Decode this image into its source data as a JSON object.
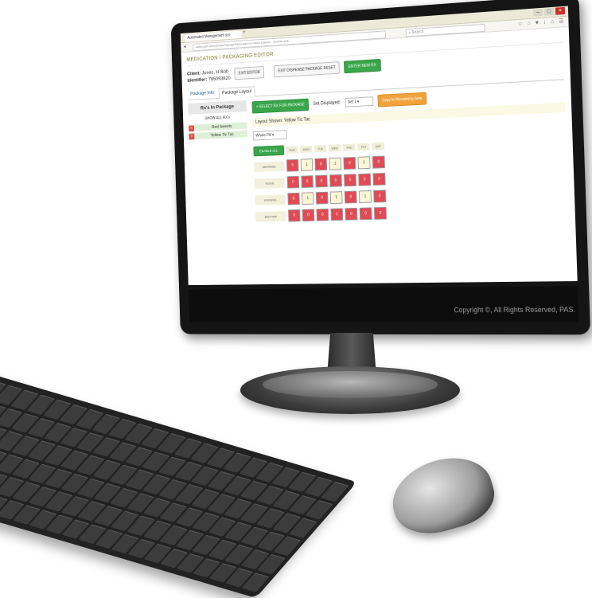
{
  "browser": {
    "tab_title": "Automated Management sys",
    "url": "www.pasit.net/example/PackageEditor.aspx?a=m&id=1&item=...&mode=edit",
    "search_placeholder": "Search"
  },
  "app": {
    "title": "MEDICATION / PACKAGING EDITOR",
    "client_label": "Client:",
    "client_value": "Jones, H Bob",
    "identifier_label": "Identifier:",
    "identifier_value": "785093820",
    "buttons": {
      "exit_editor": "EXIT EDITOR",
      "exit_dispense": "EXIT DISPENSE PACKAGE RESET",
      "enter_new_rx": "ENTER NEW RX"
    },
    "tabs": [
      "Package Info",
      "Package Layout"
    ]
  },
  "rx_panel": {
    "header": "Rx's In Package",
    "show_all": "SHOW ALL RX's",
    "items": [
      {
        "label": "Red Sweets"
      },
      {
        "label": "Yellow Tic Tac"
      }
    ]
  },
  "layout": {
    "select_rx_button": "+ SELECT RX FOR PACKAGE",
    "set_displayed_label": "Set Displayed:",
    "set_value": "Set 1",
    "copy_button": "Copy to Remaining Sets",
    "layout_shown": "Layout Shown: Yellow Tic Tac",
    "pill_select": "Whole Pill",
    "enable_all": "ENABLE ALL",
    "days": [
      "SUN",
      "MON",
      "TUE",
      "WED",
      "THU",
      "FRI",
      "SAT"
    ],
    "times": [
      "MORNING",
      "NOON",
      "EVENING",
      "BEDTIME"
    ],
    "grid": [
      [
        "0",
        "1",
        "0",
        "1",
        "0",
        "1",
        "0"
      ],
      [
        "0",
        "0",
        "0",
        "0",
        "0",
        "0",
        "0"
      ],
      [
        "0",
        "1",
        "0",
        "1",
        "0",
        "1",
        "0"
      ],
      [
        "0",
        "0",
        "0",
        "0",
        "0",
        "0",
        "0"
      ]
    ]
  },
  "footer": {
    "copyright": "Copyright ©, All Rights Reserved, PAS."
  }
}
